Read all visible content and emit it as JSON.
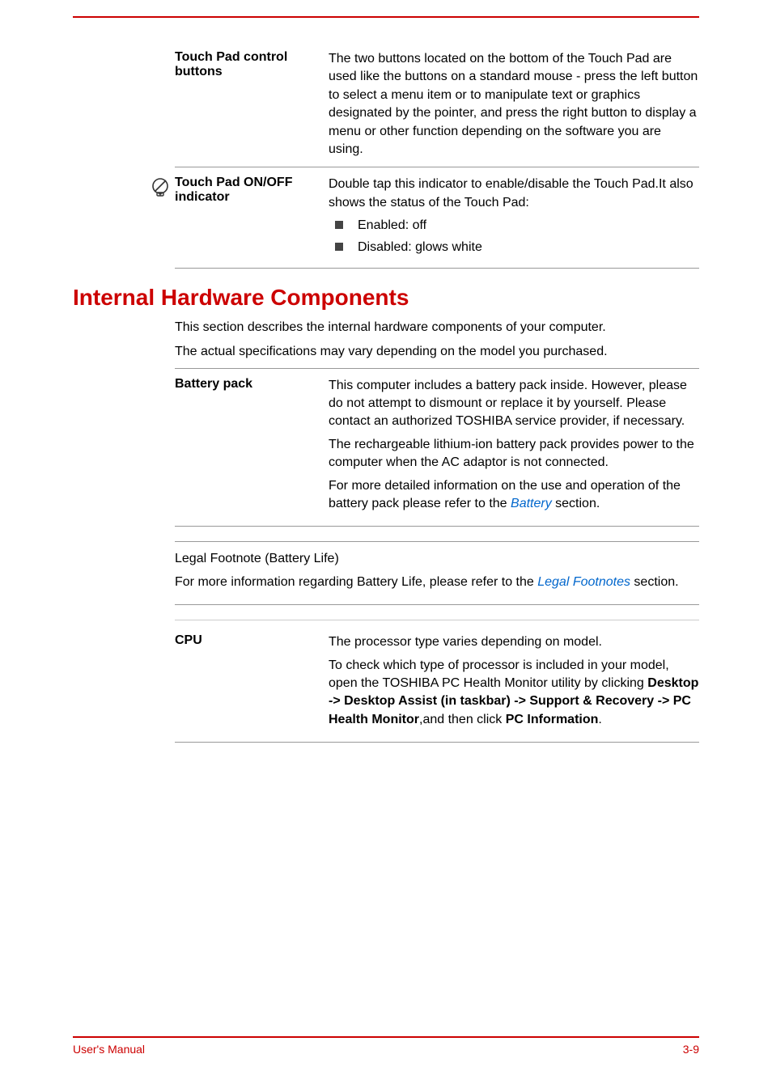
{
  "rows": {
    "touchpad_ctrl": {
      "label": "Touch Pad control buttons",
      "desc": "The two buttons located on the bottom of the Touch Pad are used like the buttons on a standard mouse - press the left button to select a menu item or to manipulate text or graphics designated by the pointer, and press the right button to display a menu or other function depending on the software you are using."
    },
    "touchpad_onoff": {
      "label": "Touch Pad ON/OFF indicator",
      "desc_intro": "Double tap this indicator to enable/disable the Touch Pad.It also shows the status of the Touch Pad:",
      "bullets": [
        "Enabled: off",
        "Disabled: glows white"
      ]
    }
  },
  "section_heading": "Internal Hardware Components",
  "intro": [
    "This section describes the internal hardware components of your computer.",
    "The actual specifications may vary depending on the model you purchased."
  ],
  "battery": {
    "label": "Battery pack",
    "p1": "This computer includes a battery pack inside. However, please do not attempt to dismount or replace it by yourself. Please contact an authorized TOSHIBA service provider, if necessary.",
    "p2": "The rechargeable lithium-ion battery pack provides power to the computer when the AC adaptor is not connected.",
    "p3_prefix": "For more detailed information on the use and operation of the battery pack please refer to the ",
    "p3_link": "Battery",
    "p3_suffix": " section."
  },
  "footnote": {
    "title": "Legal Footnote (Battery Life)",
    "text_prefix": "For more information regarding Battery Life, please refer to the ",
    "text_link": "Legal Footnotes",
    "text_suffix": " section."
  },
  "cpu": {
    "label": "CPU",
    "p1": "The processor type varies depending on model.",
    "p2_prefix": "To check which type of processor is included in your model, open the TOSHIBA PC Health Monitor utility by clicking ",
    "p2_bold1": "Desktop -> Desktop Assist (in taskbar) -> Support & Recovery -> PC Health Monitor",
    "p2_mid": ",and then click ",
    "p2_bold2": "PC Information",
    "p2_end": "."
  },
  "footer": {
    "left": "User's Manual",
    "right": "3-9"
  }
}
